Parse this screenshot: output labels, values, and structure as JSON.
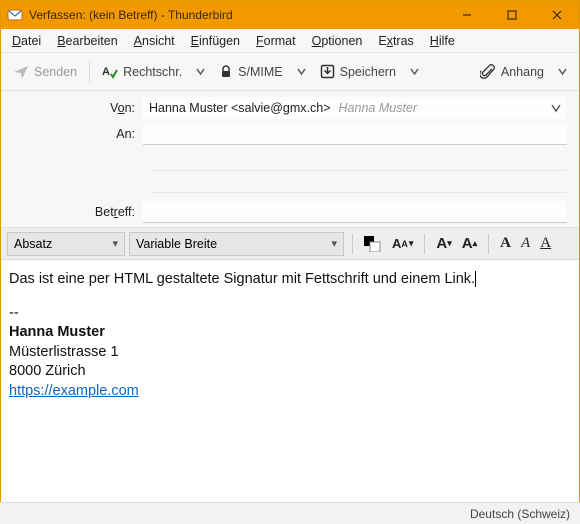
{
  "window": {
    "title": "Verfassen: (kein Betreff) - Thunderbird"
  },
  "menu": {
    "file": "Datei",
    "edit": "Bearbeiten",
    "view": "Ansicht",
    "insert": "Einfügen",
    "format": "Format",
    "options": "Optionen",
    "extras": "Extras",
    "help": "Hilfe"
  },
  "toolbar": {
    "send": "Senden",
    "spell": "Rechtschr.",
    "smime": "S/MIME",
    "save": "Speichern",
    "attach": "Anhang"
  },
  "headers": {
    "from_label_pre": "V",
    "from_label_u": "o",
    "from_label_post": "n:",
    "from_value": "Hanna Muster <salvie@gmx.ch>",
    "from_hint": "Hanna Muster",
    "to_label": "An:",
    "subject_label_pre": "Bet",
    "subject_label_u": "r",
    "subject_label_post": "eff:",
    "subject_value": ""
  },
  "format": {
    "para_style": "Absatz",
    "font_family": "Variable Breite"
  },
  "body": {
    "line1": "Das ist eine per HTML gestaltete Signatur mit Fettschrift und einem Link.",
    "sep": "--",
    "name": "Hanna Muster",
    "street": "Müsterlistrasse 1",
    "city": "8000 Zürich",
    "url": "https://example.com"
  },
  "status": {
    "lang": "Deutsch (Schweiz)"
  }
}
